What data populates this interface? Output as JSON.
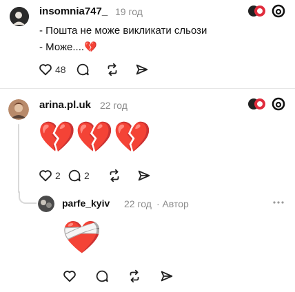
{
  "posts": [
    {
      "username": "insomnia747_",
      "time": "19 год",
      "lines": [
        "- Пошта не може викликати сльози",
        "- Може....💔"
      ],
      "likes": "48"
    },
    {
      "username": "arina.pl.uk",
      "time": "22 год",
      "emoji": "💔💔💔",
      "likes": "2",
      "replies": "2"
    },
    {
      "username": "parfe_kyiv",
      "time": "22 год",
      "author_badge": "· Автор",
      "emoji": "❤️‍🩹"
    }
  ],
  "icons": {
    "like": "heart-icon",
    "reply": "reply-bubble-icon",
    "repost": "repost-icon",
    "share": "share-send-icon",
    "threads": "threads-logo-icon",
    "badge": "heart-badge-icon",
    "more": "more-dots-icon"
  },
  "colors": {
    "text": "#101010",
    "muted": "#8a8a8a",
    "thread_line": "#d9d9d9",
    "badge_red": "#e02c3c"
  }
}
